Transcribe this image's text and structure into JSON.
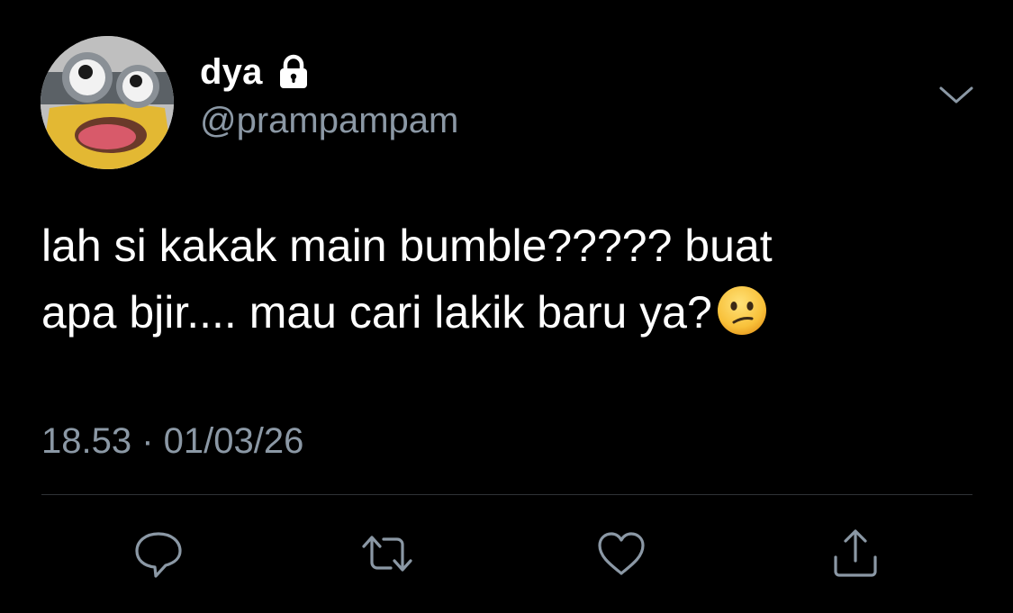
{
  "user": {
    "display_name": "dya",
    "handle": "@prampampam",
    "protected_icon": "lock-icon",
    "avatar_icon": "avatar-image"
  },
  "tweet": {
    "text_line_1": "lah si kakak main bumble????? buat",
    "text_line_2": "apa bjir.... mau cari lakik baru ya?",
    "emoji_icon": "confused-face-emoji",
    "timestamp": "18.53 · 01/03/26"
  },
  "menu": {
    "icon": "chevron-down-icon"
  },
  "actions": [
    {
      "icon": "reply-icon"
    },
    {
      "icon": "retweet-icon"
    },
    {
      "icon": "like-icon"
    },
    {
      "icon": "share-icon"
    }
  ],
  "colors": {
    "background": "#000000",
    "primary_text": "#ffffff",
    "secondary_text": "#8b98a5",
    "divider": "#2f3336"
  }
}
